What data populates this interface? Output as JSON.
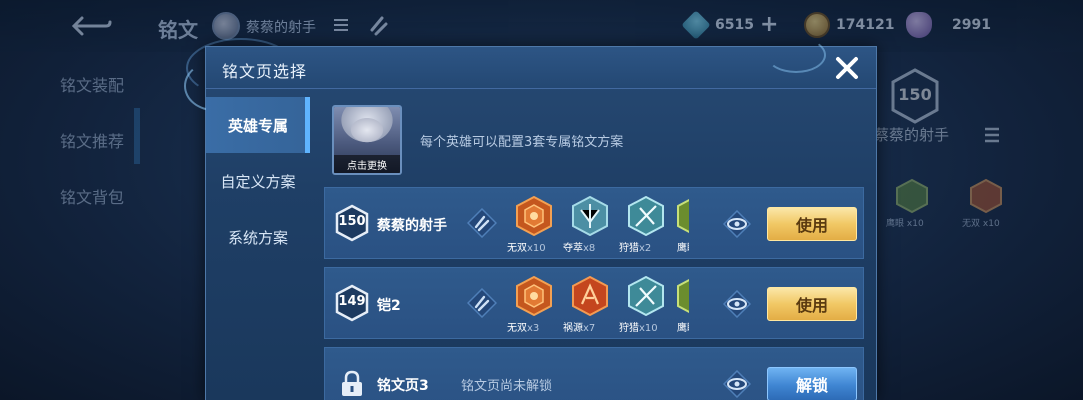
{
  "background": {
    "title": "铭文",
    "hero_name": "蔡蔡的射手",
    "currency": [
      {
        "value": "6515",
        "icon": "crystal-icon",
        "color": "#3fa6c6"
      },
      {
        "value": "174121",
        "icon": "gold-coin-icon",
        "color": "#c99a3a"
      },
      {
        "value": "2991",
        "icon": "diamond-icon",
        "color": "#9b7ec9"
      }
    ],
    "sidebar": [
      "铭文装配",
      "铭文推荐",
      "铭文背包"
    ],
    "right_level": "150",
    "right_name": "蔡蔡的射手",
    "right_runes": [
      {
        "name": "鹰眼",
        "count": "x10"
      },
      {
        "name": "无双",
        "count": "x10"
      }
    ]
  },
  "dialog": {
    "title": "铭文页选择",
    "tabs": [
      "英雄专属",
      "自定义方案",
      "系统方案"
    ],
    "active_tab": 0,
    "hero_caption": "点击更换",
    "hero_hint": "每个英雄可以配置3套专属铭文方案",
    "pages": [
      {
        "level": "150",
        "name": "蔡蔡的射手",
        "runes": [
          {
            "name": "无双",
            "count": "x10",
            "color": "orange"
          },
          {
            "name": "夺萃",
            "count": "x8",
            "color": "teal"
          },
          {
            "name": "狩猎",
            "count": "x2",
            "color": "teal"
          },
          {
            "name": "鹰眼",
            "count": "",
            "color": "green"
          }
        ],
        "action": "使用"
      },
      {
        "level": "149",
        "name": "铠2",
        "runes": [
          {
            "name": "无双",
            "count": "x3",
            "color": "orange"
          },
          {
            "name": "祸源",
            "count": "x7",
            "color": "orange"
          },
          {
            "name": "狩猎",
            "count": "x10",
            "color": "teal"
          },
          {
            "name": "鹰眼",
            "count": "",
            "color": "green"
          }
        ],
        "action": "使用"
      }
    ],
    "locked_page": {
      "name": "铭文页3",
      "status": "铭文页尚未解锁",
      "action": "解锁"
    }
  }
}
